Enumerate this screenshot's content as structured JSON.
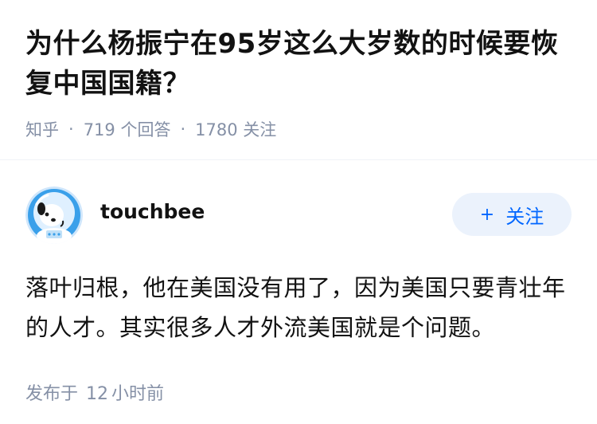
{
  "question": {
    "title": "为什么杨振宁在95岁这么大岁数的时候要恢复中国国籍？",
    "source": "知乎",
    "answer_count": "719",
    "answer_count_unit": "个回答",
    "follower_count": "1780",
    "follower_count_unit": "关注"
  },
  "answer": {
    "author": {
      "name": "touchbee",
      "avatar_icon": "astronaut-dog-avatar-icon"
    },
    "follow_button": {
      "icon": "plus-icon",
      "label": "关注"
    },
    "content": "落叶归根，他在美国没有用了，因为美国只要青壮年的人才。其实很多人才外流美国就是个问题。",
    "published_label": "发布于",
    "published_amount": "12",
    "published_unit": "小时前"
  },
  "colors": {
    "meta_gray": "#8590a6",
    "follow_bg": "#ebf2fc",
    "follow_text": "#0066ff",
    "avatar_blue": "#3aa0ea",
    "divider": "#f0f2f7"
  }
}
